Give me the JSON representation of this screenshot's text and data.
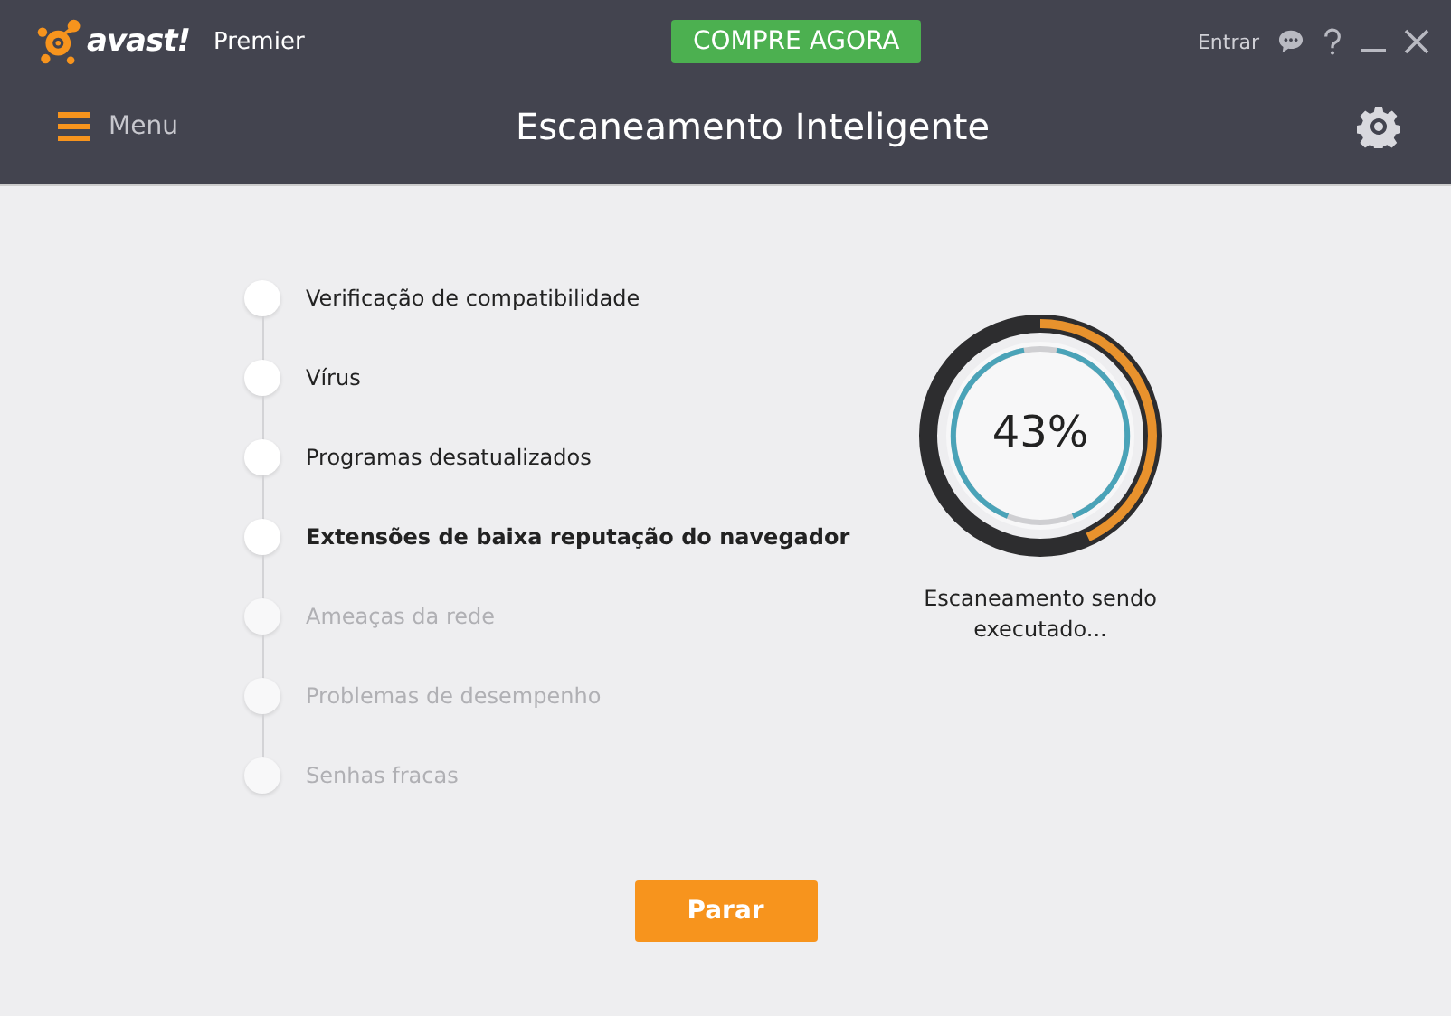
{
  "header": {
    "logo": "avast!",
    "edition": "Premier",
    "buy_button": "COMPRE AGORA",
    "login": "Entrar",
    "menu": "Menu",
    "title": "Escaneamento Inteligente"
  },
  "steps": [
    {
      "label": "Verificação de compatibilidade",
      "kind": "done"
    },
    {
      "label": "Vírus",
      "kind": "done"
    },
    {
      "label": "Programas desatualizados",
      "kind": "done"
    },
    {
      "label": "Extensões de baixa reputação do navegador",
      "kind": "active"
    },
    {
      "label": "Ameaças da rede",
      "kind": "pending"
    },
    {
      "label": "Problemas de desempenho",
      "kind": "pending"
    },
    {
      "label": "Senhas fracas",
      "kind": "pending"
    }
  ],
  "progress": {
    "level": 0.43,
    "reading": "43%",
    "caption": "Escaneamento sendo executado..."
  },
  "stop_button": "Parar"
}
